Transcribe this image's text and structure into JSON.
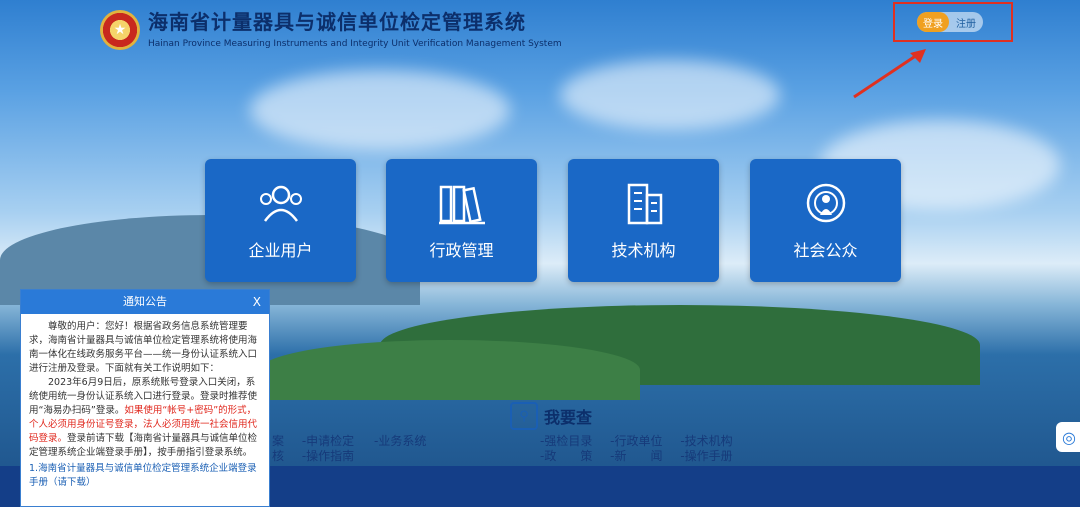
{
  "header": {
    "title_cn": "海南省计量器具与诚信单位检定管理系统",
    "title_en": "Hainan Province Measuring Instruments and Integrity Unit Verification Management System",
    "emblem_icon": "national-emblem"
  },
  "auth": {
    "login": "登录",
    "register": "注册"
  },
  "tiles": [
    {
      "label": "企业用户",
      "icon": "users-icon"
    },
    {
      "label": "行政管理",
      "icon": "binders-icon"
    },
    {
      "label": "技术机构",
      "icon": "building-icon"
    },
    {
      "label": "社会公众",
      "icon": "public-icon"
    }
  ],
  "search": {
    "title": "我要查"
  },
  "links_left": {
    "row1": [
      "案",
      "-申请检定",
      "-业务系统"
    ],
    "row2": [
      "核",
      "-操作指南"
    ]
  },
  "links_right": {
    "row1": [
      "-强检目录",
      "-行政单位",
      "-技术机构"
    ],
    "row2": [
      "-政　　策",
      "-新　　闻",
      "-操作手册"
    ]
  },
  "notice": {
    "title": "通知公告",
    "close": "X",
    "para1": "尊敬的用户：您好！根据省政务信息系统管理要求，海南省计量器具与诚信单位检定管理系统将使用海南一体化在线政务服务平台——统一身份认证系统入口进行注册及登录。下面就有关工作说明如下：",
    "para2_a": "2023年6月9日后，原系统账号登录入口关闭，系统使用统一身份认证系统入口进行登录。登录时推荐使用“海易办扫码”登录。",
    "para2_red": "如果使用“帐号+密码”的形式，个人必须用身份证号登录，法人必须用统一社会信用代码登录。",
    "para2_b": "登录前请下载【海南省计量器具与诚信单位检定管理系统企业端登录手册】，按手册指引登录系统。",
    "link": "1.海南省计量器具与诚信单位检定管理系统企业端登录手册（请下载）"
  },
  "colors": {
    "tile": "#1a68c6",
    "login": "#f0a020",
    "highlight": "#e03020"
  }
}
